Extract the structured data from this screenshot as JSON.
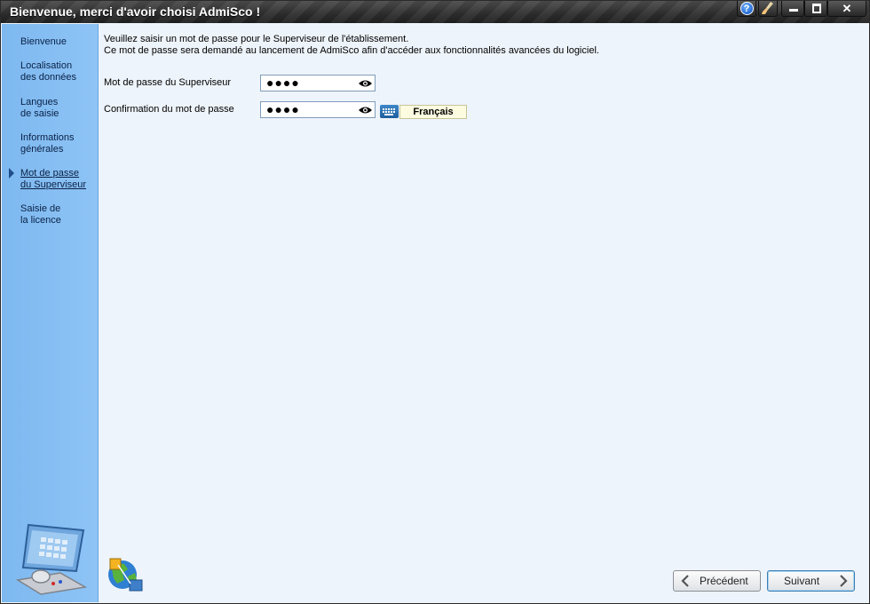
{
  "window": {
    "title": "Bienvenue, merci d'avoir choisi AdmiSco !"
  },
  "titlebar": {
    "help_glyph": "?",
    "close_glyph": "✕"
  },
  "sidebar": {
    "items": [
      {
        "label": "Bienvenue"
      },
      {
        "label": "Localisation\ndes données"
      },
      {
        "label": "Langues\nde saisie"
      },
      {
        "label": "Informations\ngénérales"
      },
      {
        "label": "Mot de passe\ndu Superviseur",
        "active": true
      },
      {
        "label": "Saisie de\nla licence"
      }
    ]
  },
  "content": {
    "intro_line1": "Veuillez saisir un mot de passe pour le Superviseur de l'établissement.",
    "intro_line2": "Ce mot de passe sera demandé au lancement de AdmiSco afin d'accéder aux fonctionnalités avancées du logiciel.",
    "password_label": "Mot de passe du Superviseur",
    "password_value": "●●●●",
    "confirm_label": "Confirmation du mot de passe",
    "confirm_value": "●●●●",
    "keyboard_language": "Français"
  },
  "footer": {
    "prev_label": "Précédent",
    "next_label": "Suivant"
  },
  "icons": [
    "help-icon",
    "brush-icon",
    "eye-icon",
    "keyboard-icon",
    "monitor-icon",
    "globe-icon",
    "chevron-left-icon",
    "chevron-right-icon"
  ],
  "colors": {
    "sidebar": "#8ec4f6",
    "content": "#eef4fb",
    "titlebar": "#2d2d2d"
  }
}
